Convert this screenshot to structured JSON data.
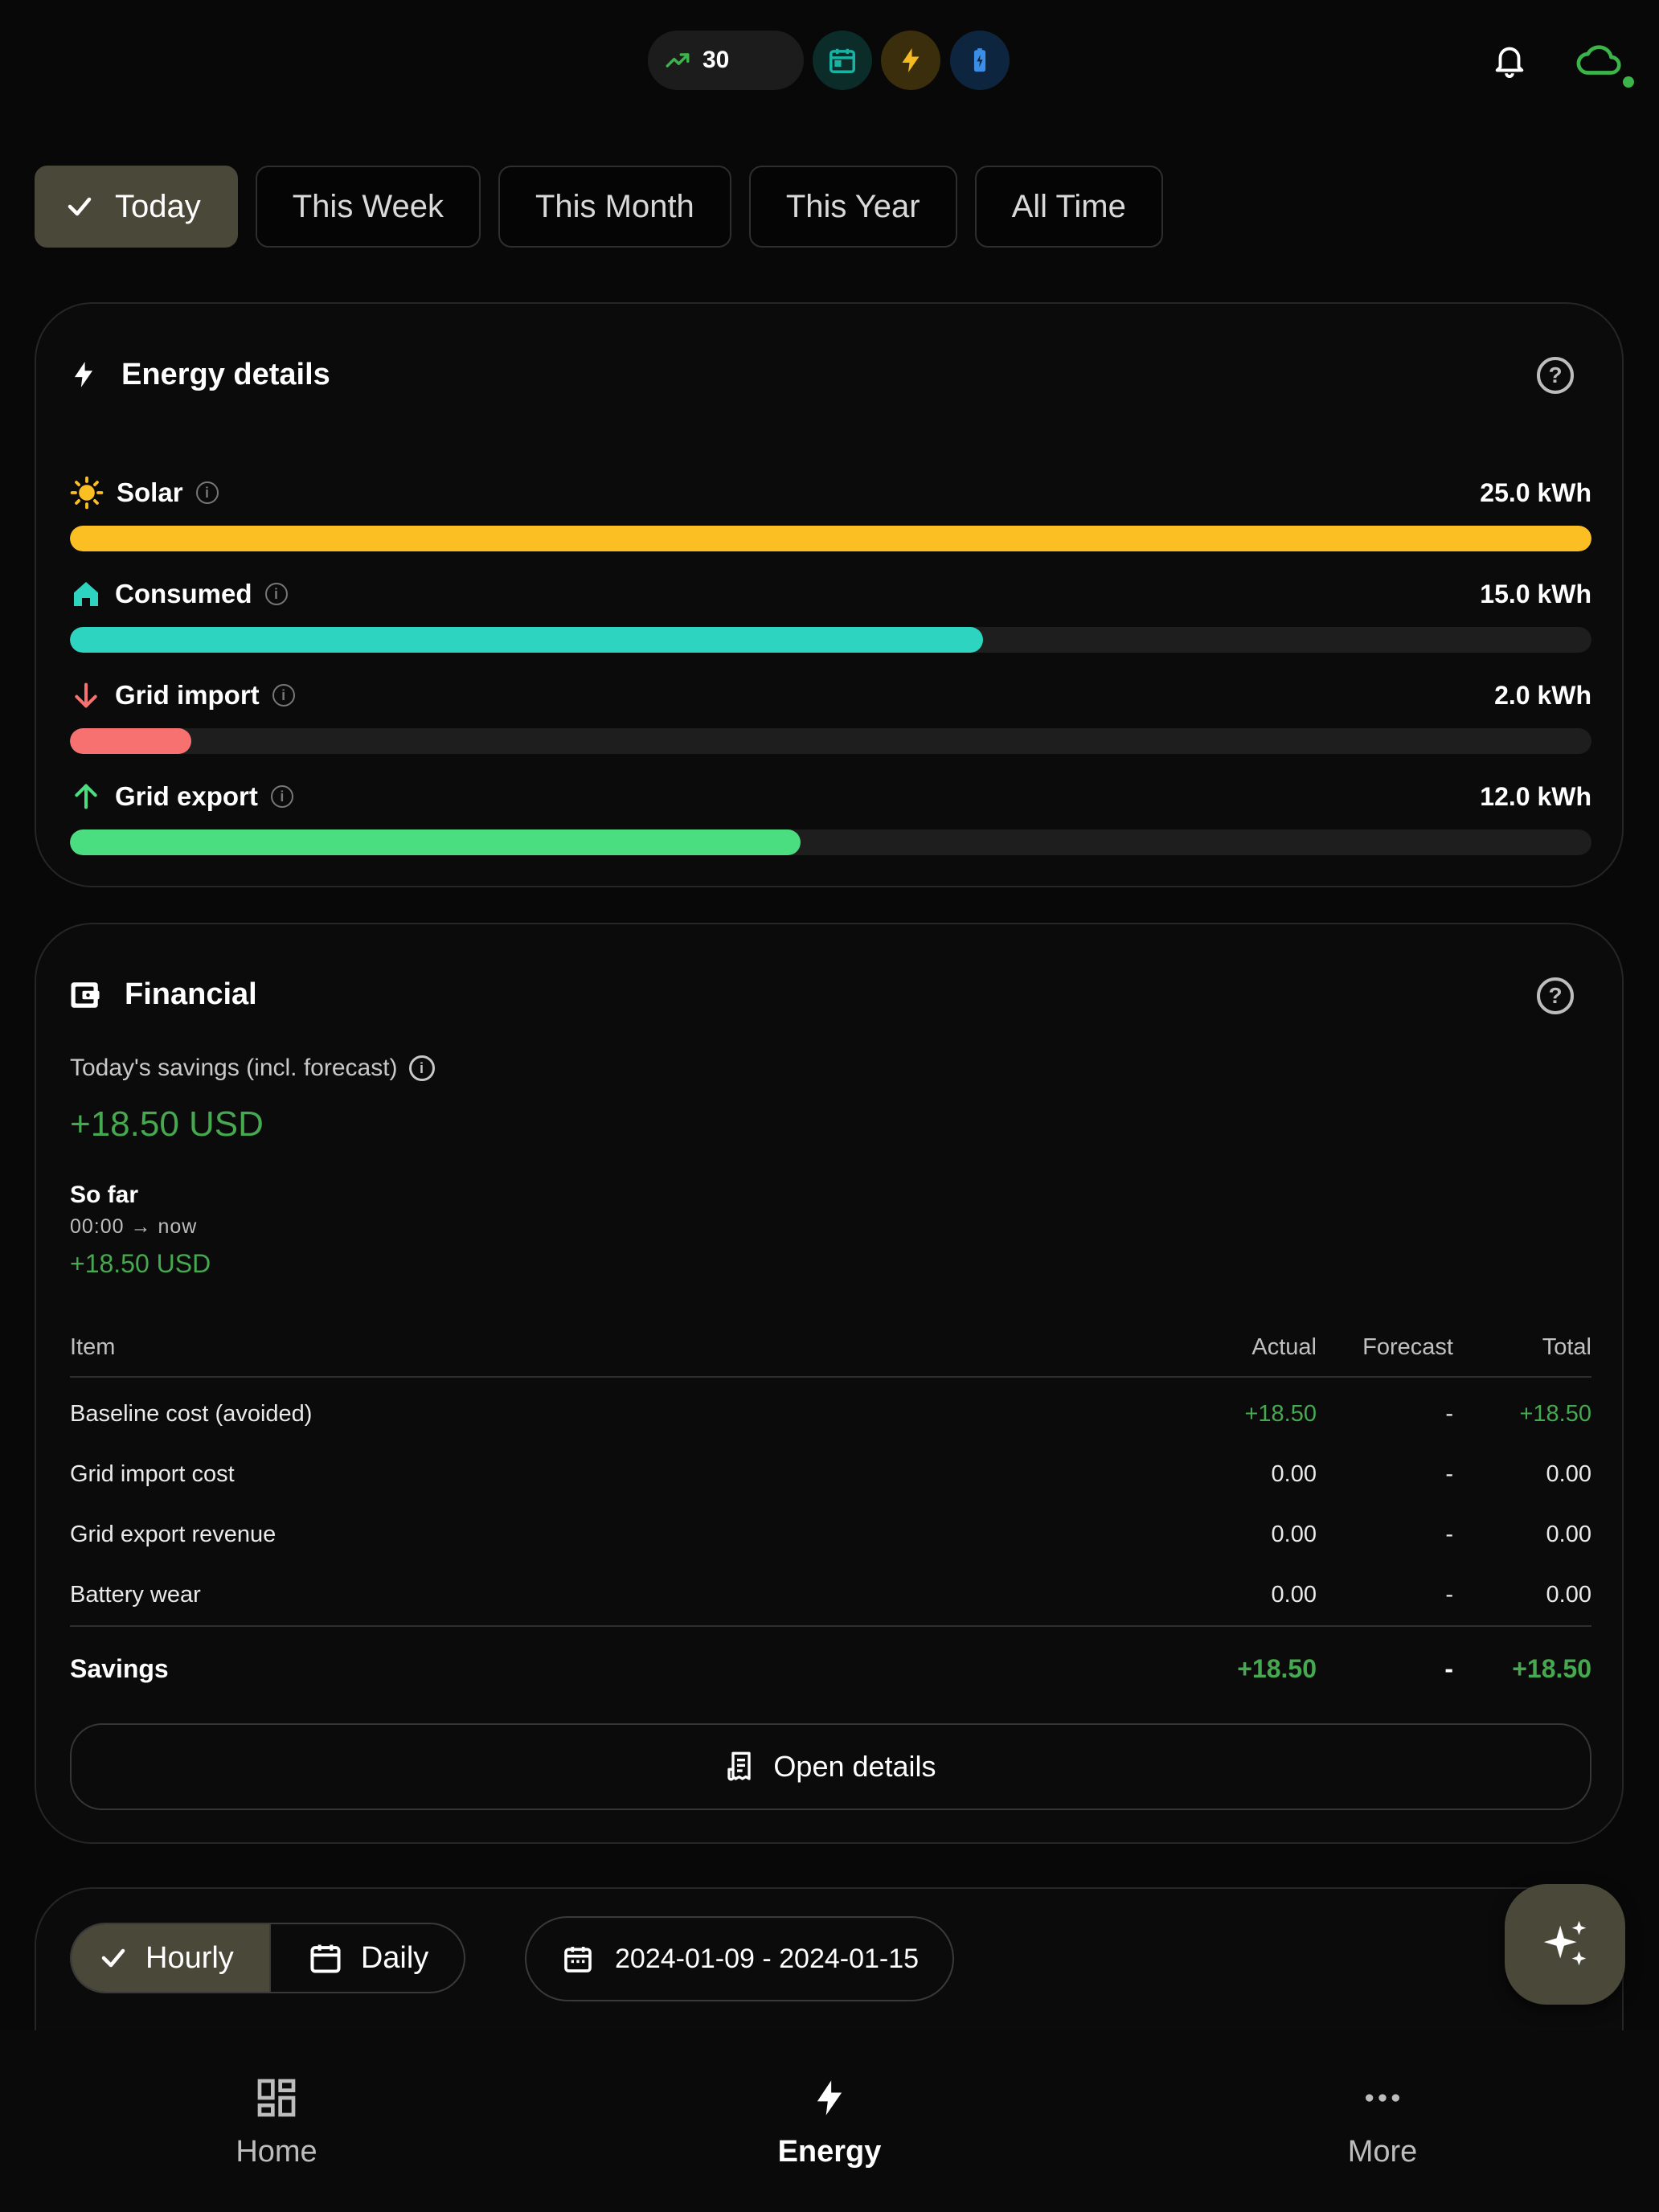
{
  "topbar": {
    "trend_value": "30",
    "colors": {
      "trend": "#3bb54a",
      "calendar": "#19b3a4",
      "bolt": "#f5b921",
      "battery": "#3a8ee6",
      "cloud": "#3bb54a"
    }
  },
  "periods": [
    {
      "label": "Today",
      "active": true
    },
    {
      "label": "This Week",
      "active": false
    },
    {
      "label": "This Month",
      "active": false
    },
    {
      "label": "This Year",
      "active": false
    },
    {
      "label": "All Time",
      "active": false
    }
  ],
  "energy": {
    "title": "Energy details",
    "rows": [
      {
        "label": "Solar",
        "value": "25.0 kWh",
        "fraction": 1.0,
        "color": "#fbbf24",
        "icon": "sun-icon"
      },
      {
        "label": "Consumed",
        "value": "15.0 kWh",
        "fraction": 0.6,
        "color": "#2dd4bf",
        "icon": "home-icon"
      },
      {
        "label": "Grid import",
        "value": "2.0 kWh",
        "fraction": 0.08,
        "color": "#f87171",
        "icon": "arrow-down-icon"
      },
      {
        "label": "Grid export",
        "value": "12.0 kWh",
        "fraction": 0.48,
        "color": "#4ade80",
        "icon": "arrow-up-icon"
      }
    ]
  },
  "financial": {
    "title": "Financial",
    "savings_label": "Today's savings (incl. forecast)",
    "savings_value": "+18.50 USD",
    "so_far_title": "So far",
    "so_far_range": "00:00 → now",
    "so_far_value": "+18.50 USD",
    "columns": [
      "Item",
      "Actual",
      "Forecast",
      "Total"
    ],
    "rows": [
      {
        "item": "Baseline cost (avoided)",
        "actual": "+18.50",
        "forecast": "-",
        "total": "+18.50"
      },
      {
        "item": "Grid import cost",
        "actual": "0.00",
        "forecast": "-",
        "total": "0.00"
      },
      {
        "item": "Grid export revenue",
        "actual": "0.00",
        "forecast": "-",
        "total": "0.00"
      },
      {
        "item": "Battery wear",
        "actual": "0.00",
        "forecast": "-",
        "total": "0.00"
      }
    ],
    "summary": {
      "item": "Savings",
      "actual": "+18.50",
      "forecast": "-",
      "total": "+18.50"
    },
    "open_details": "Open details"
  },
  "chart_controls": {
    "hourly": "Hourly",
    "daily": "Daily",
    "date_range": "2024-01-09 - 2024-01-15"
  },
  "nav": [
    {
      "label": "Home",
      "active": false
    },
    {
      "label": "Energy",
      "active": true
    },
    {
      "label": "More",
      "active": false
    }
  ]
}
